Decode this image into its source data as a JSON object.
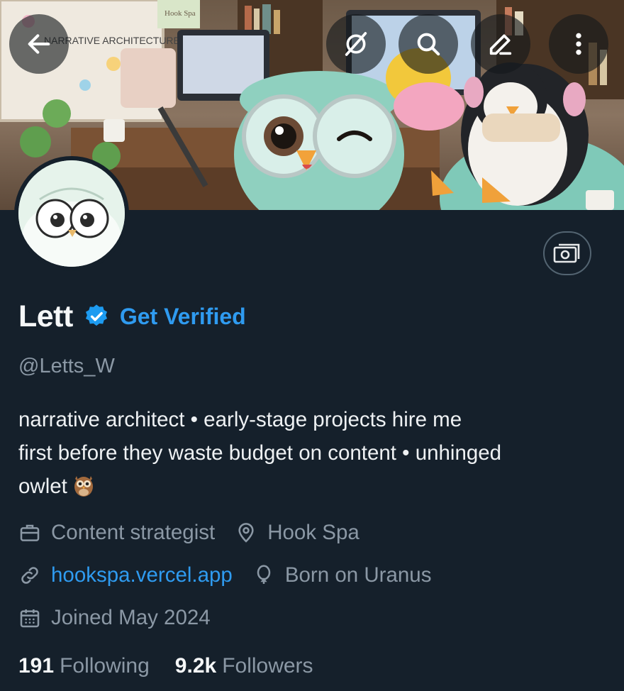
{
  "banner": {
    "board_text": "NARRATIVE ARCHITECTURE",
    "sign_text": "Hook Spa"
  },
  "toolbar": {
    "back": "back-arrow-icon",
    "grok": "grok-icon",
    "search": "search-icon",
    "edit": "edit-icon",
    "more": "more-icon"
  },
  "profile": {
    "name": "Lett",
    "get_verified": "Get Verified",
    "handle": "@Letts_W",
    "bio_line1": "narrative architect • early-stage projects hire me",
    "bio_line2": "first before they waste budget on content • unhinged",
    "bio_line3": "owlet",
    "category": "Content strategist",
    "location": "Hook Spa",
    "website": "hookspa.vercel.app",
    "birthplace": "Born on Uranus",
    "joined": "Joined May 2024",
    "following_count": "191",
    "following_label": "Following",
    "followers_count": "9.2k",
    "followers_label": "Followers"
  },
  "colors": {
    "background": "#15202b",
    "accent": "#2f9bf0",
    "muted": "#8b98a5"
  }
}
